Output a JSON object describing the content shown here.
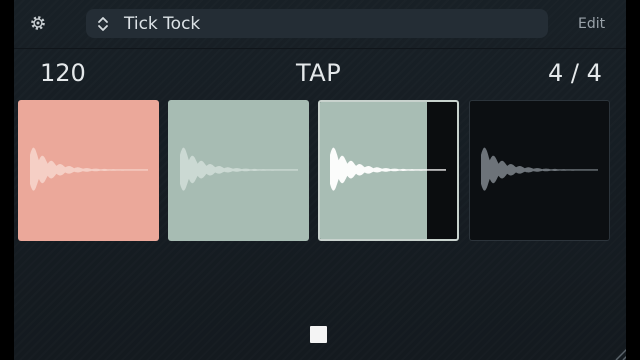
{
  "header": {
    "settings_icon": "gear-icon",
    "preset_arrows_icon": "up-down-chevron-icon",
    "preset_name": "Tick Tock",
    "edit_label": "Edit"
  },
  "transport": {
    "bpm": "120",
    "tap_label": "TAP",
    "time_signature": "4 / 4"
  },
  "beats": [
    {
      "state": "accent",
      "color": "#eba89a"
    },
    {
      "state": "normal",
      "color": "#a7bcb3"
    },
    {
      "state": "current",
      "color": "#a8bdb4",
      "progress": 0.78
    },
    {
      "state": "muted",
      "color": "#0c0f12"
    }
  ],
  "footer": {
    "stop_icon": "stop-icon",
    "resize_icon": "resize-grip-icon"
  },
  "colors": {
    "background": "#161d23",
    "preset_bar": "#242d35",
    "text": "#e4e8ea",
    "accent_beat": "#eba89a",
    "normal_beat": "#a7bcb3"
  }
}
